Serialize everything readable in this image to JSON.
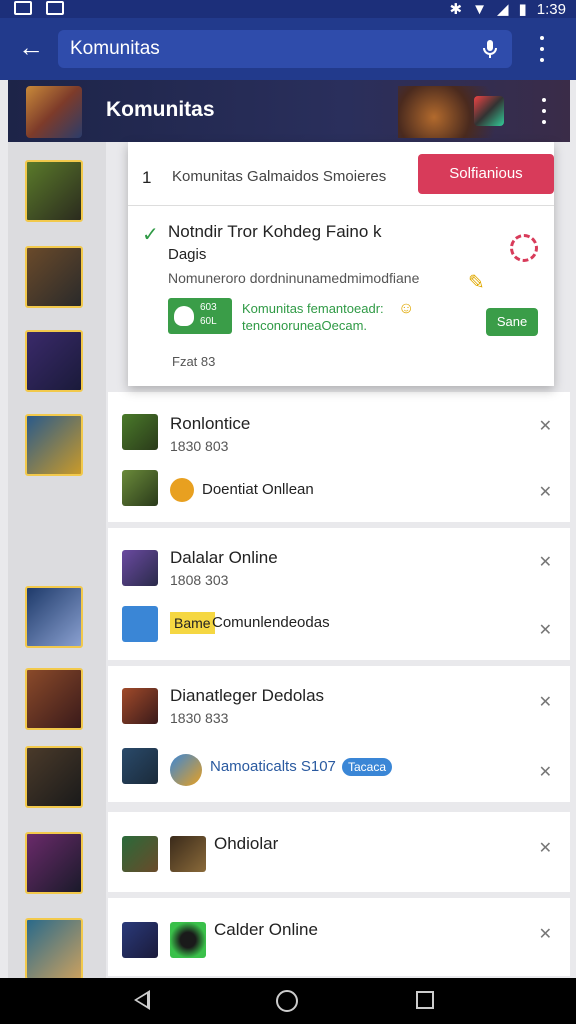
{
  "status_bar": {
    "time": "1:39"
  },
  "app_bar": {
    "search_value": "Komunitas"
  },
  "community": {
    "title": "Komunitas"
  },
  "popup": {
    "number": "1",
    "header": "Komunitas Galmaidos Smoieres",
    "action_button": "Solfianious",
    "card_title": "Notndir Tror Kohdeg Faino k",
    "card_sub": "Dagis",
    "card_desc": "Nomuneroro dordninunamedmimodfiane",
    "badge_text_line1": "603",
    "badge_text_line2": "60L",
    "note_line1": "Komunitas femantoeadr:",
    "note_line2": "tenconoruneaOecam.",
    "save_button": "Sane",
    "footer": "Fzat 83"
  },
  "list": [
    {
      "name": "Ronlontice",
      "meta": "1830 803",
      "sub": "Doentiat Onllean"
    },
    {
      "name": "Dalalar Online",
      "meta": "1808 303",
      "sub_tag": "Bame",
      "sub": "Comunlendeodas"
    },
    {
      "name": "Dianatleger Dedolas",
      "meta": "1830 833",
      "sub": "Namoaticalts S107",
      "pill": "Tacaca"
    },
    {
      "name": "Ohdiolar"
    },
    {
      "name": "Calder Online"
    }
  ],
  "colors": {
    "app_bar": "#223a8c",
    "status_bar": "#1c2f7a",
    "accent_red": "#d83b5a",
    "accent_green": "#3a9d48"
  },
  "icons": [
    "back-arrow-icon",
    "mic-icon",
    "more-vert-icon",
    "check-icon",
    "close-icon",
    "heart-icon"
  ]
}
